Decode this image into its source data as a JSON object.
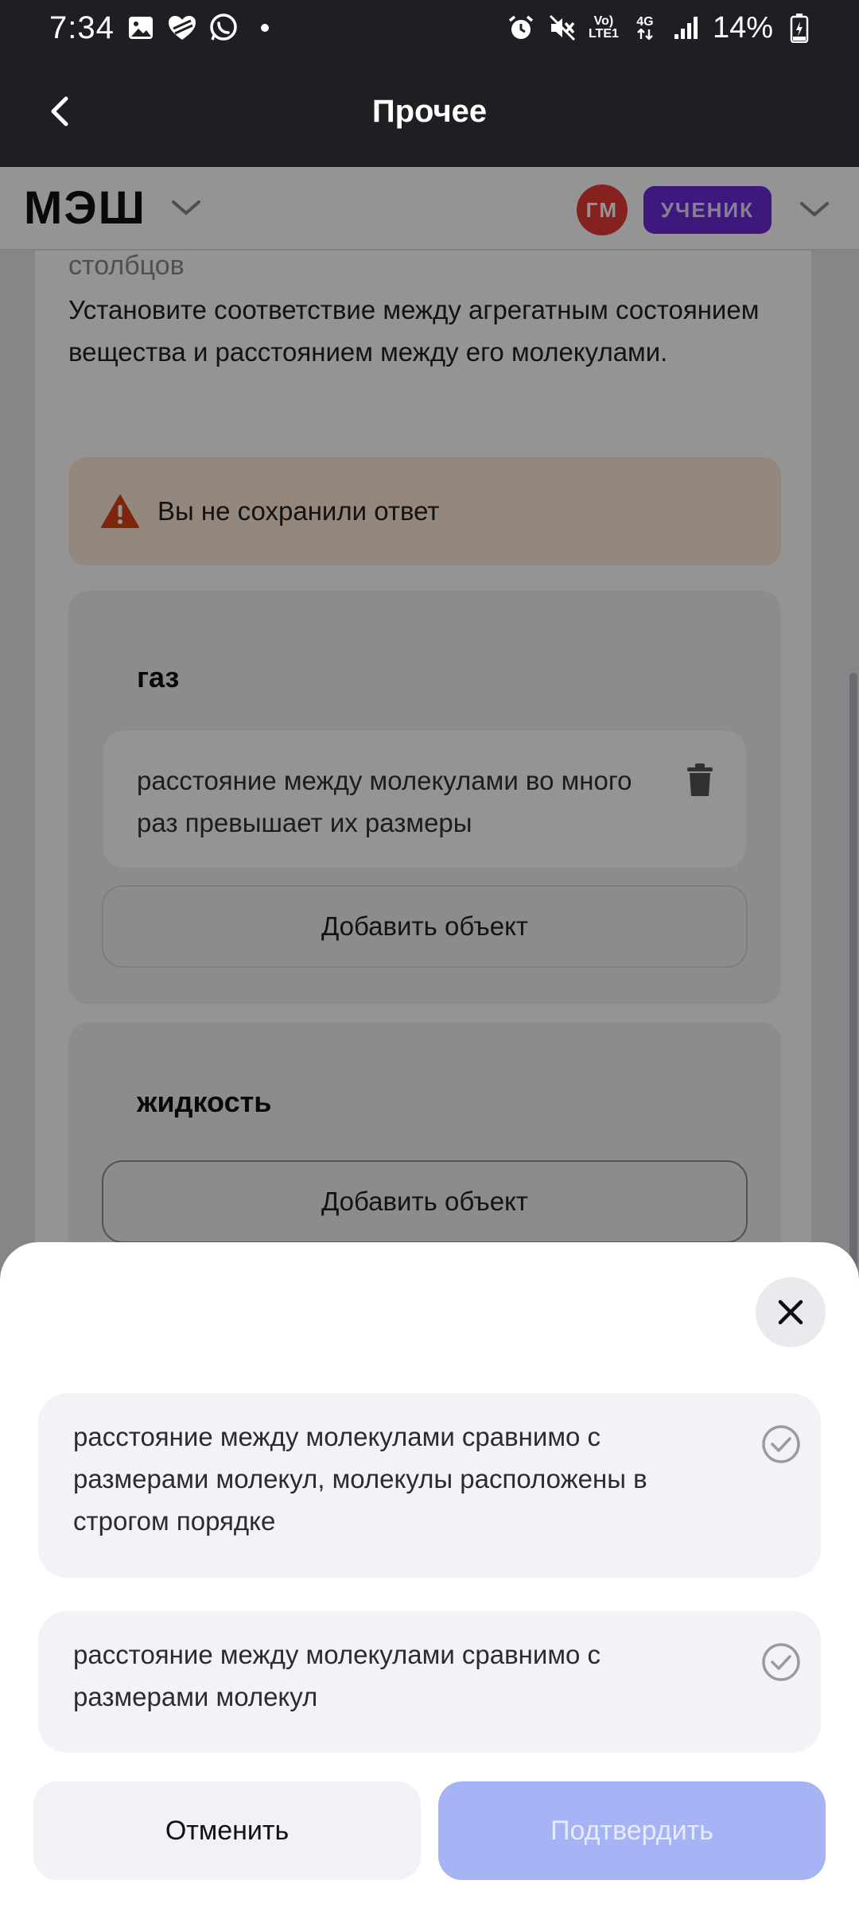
{
  "status_bar": {
    "time": "7:34",
    "left_icons": [
      "image-icon",
      "heart-icon",
      "whatsapp-icon",
      "dot-icon"
    ],
    "right_icons": [
      "alarm-icon",
      "mute-icon",
      "volte-icon",
      "network-4g-icon",
      "signal-icon",
      "battery-icon"
    ],
    "volte_label": "Vo)\nLTE1",
    "network_label": "4G",
    "battery": "14%"
  },
  "app_bar": {
    "title": "Прочее"
  },
  "site_header": {
    "logo": "МЭШ",
    "avatar_initials": "ГМ",
    "role": "УЧЕНИК",
    "colors": {
      "avatar": "#e53935",
      "role_badge": "#6a2bd9"
    }
  },
  "task": {
    "faded_heading": "столбцов",
    "question": "Установите соответствие между агрегатным состоянием вещества и расстоянием между его молекулами.",
    "warning": "Вы не сохранили ответ",
    "columns": [
      {
        "title": "газ",
        "items": [
          "расстояние между молекулами во много раз превышает их размеры"
        ],
        "add_label": "Добавить объект"
      },
      {
        "title": "жидкость",
        "items": [],
        "add_label": "Добавить объект"
      }
    ]
  },
  "sheet": {
    "options": [
      {
        "text": "расстояние между молекулами сравнимо с размерами молекул, молекулы расположены в строгом порядке"
      },
      {
        "text": "расстояние между молекулами сравнимо с размерами молекул"
      }
    ],
    "cancel_label": "Отменить",
    "confirm_label": "Подтвердить",
    "colors": {
      "confirm": "#a6b4f6",
      "warning_icon": "#d84315"
    }
  }
}
